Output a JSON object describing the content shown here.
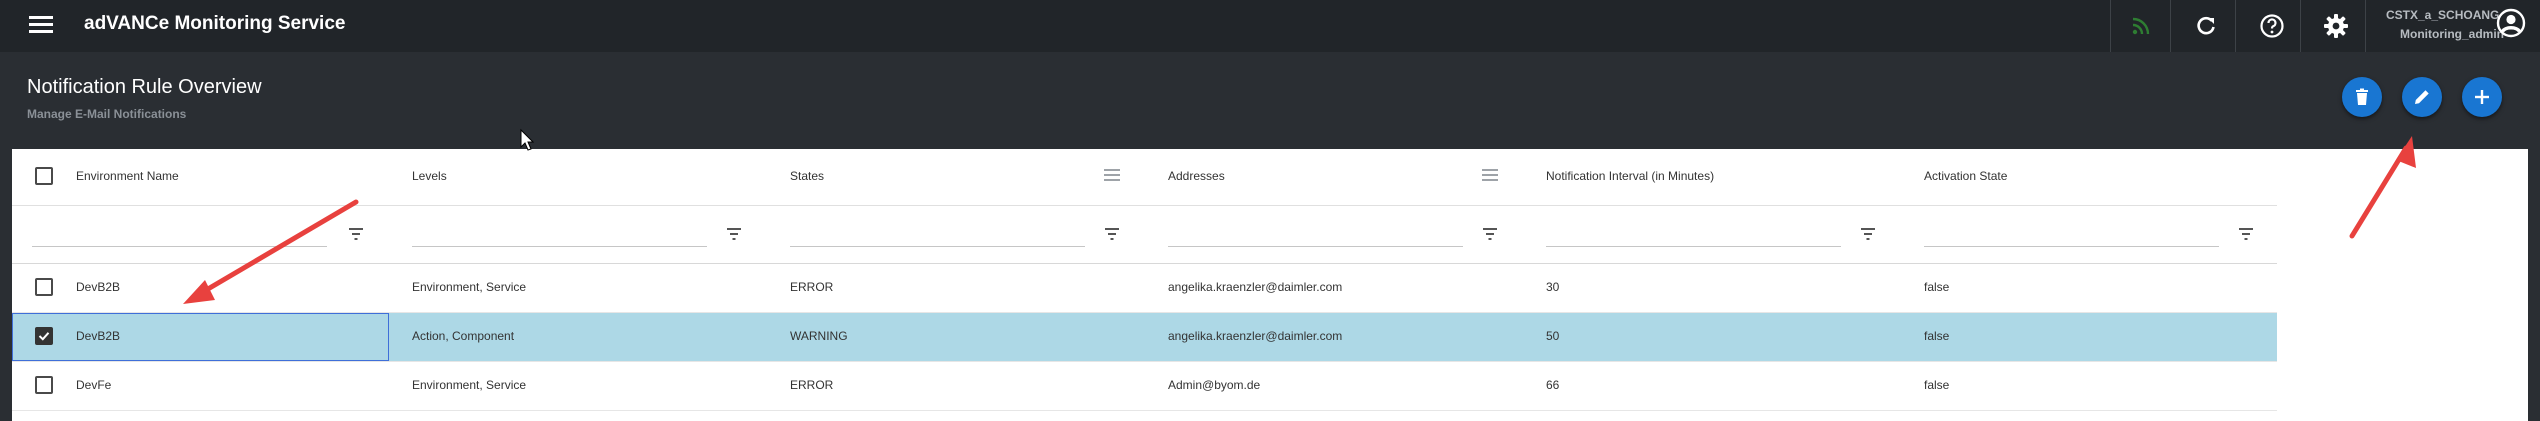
{
  "app": {
    "title": "adVANCe Monitoring Service"
  },
  "user": {
    "name": "CSTX_a_SCHOANG",
    "role": "Monitoring_admin"
  },
  "page": {
    "title": "Notification Rule Overview",
    "subtitle": "Manage E-Mail Notifications"
  },
  "columns": [
    {
      "label": "Environment Name"
    },
    {
      "label": "Levels"
    },
    {
      "label": "States"
    },
    {
      "label": "Addresses"
    },
    {
      "label": "Notification Interval (in Minutes)"
    },
    {
      "label": "Activation State"
    }
  ],
  "rows": [
    {
      "checked": false,
      "env": "DevB2B",
      "levels": "Environment, Service",
      "states": "ERROR",
      "address": "angelika.kraenzler@daimler.com",
      "interval": "30",
      "active": "false"
    },
    {
      "checked": true,
      "env": "DevB2B",
      "levels": "Action, Component",
      "states": "WARNING",
      "address": "angelika.kraenzler@daimler.com",
      "interval": "50",
      "active": "false"
    },
    {
      "checked": false,
      "env": "DevFe",
      "levels": "Environment, Service",
      "states": "ERROR",
      "address": "Admin@byom.de",
      "interval": "66",
      "active": "false"
    }
  ],
  "icons": {
    "menu": "hamburger-icon",
    "feed": "rss-icon",
    "refresh": "refresh-icon",
    "help": "help-icon",
    "settings": "gear-icon",
    "account": "account-circle-icon",
    "delete": "trash-icon",
    "edit": "pencil-icon",
    "add": "plus-icon",
    "filter": "filter-icon"
  },
  "colors": {
    "topbar": "#212529",
    "background": "#2a2e33",
    "accent": "#1976d2",
    "selected_row": "#add8e6",
    "annotation": "#e8413e",
    "feed": "#2e7d32"
  }
}
